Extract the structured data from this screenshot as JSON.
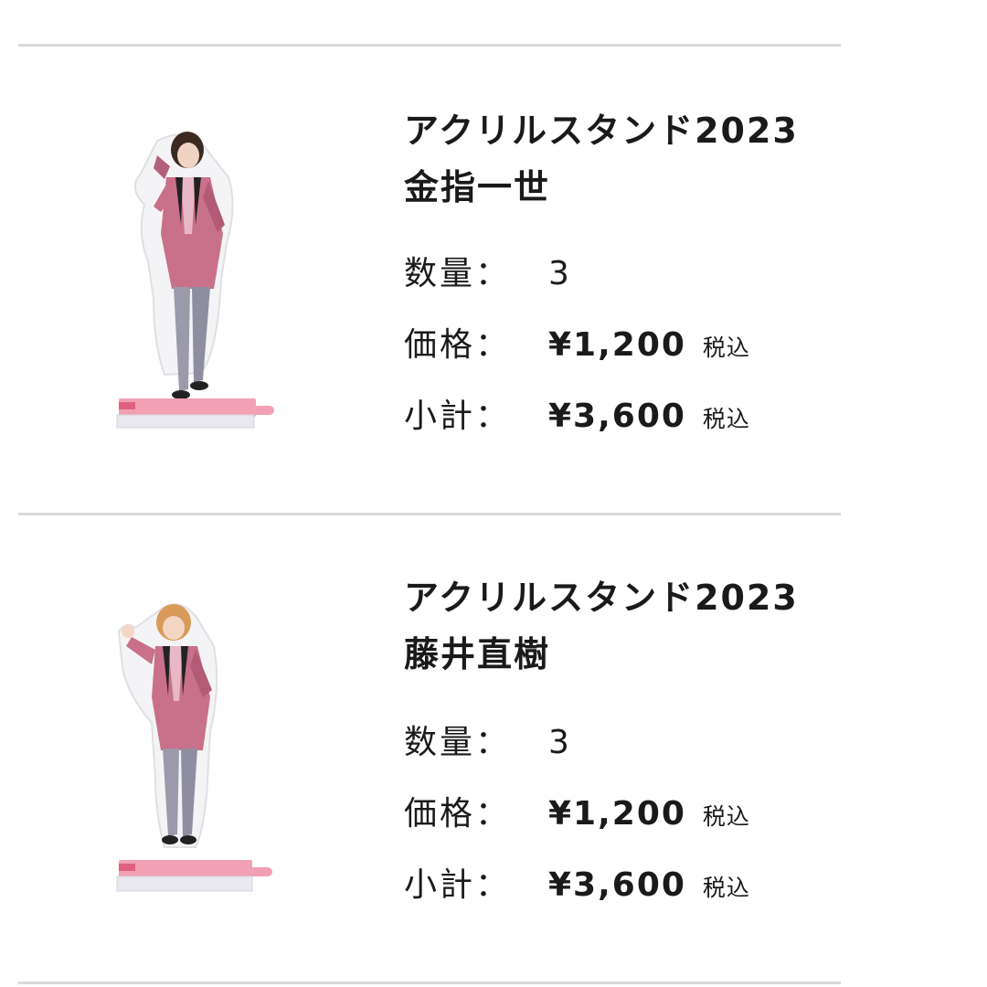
{
  "colors": {
    "divider": "#d9d9d9",
    "text": "#1a1a1a",
    "suit_pink": "#c9708a",
    "stand_base": "#f2a0b4"
  },
  "items": [
    {
      "image_icon": "acrylic-stand-figure",
      "title_line1": "アクリルスタンド2023",
      "title_line2": "金指一世",
      "quantity_label": "数量：",
      "quantity_value": "3",
      "price_label": "価格：",
      "price_value": "¥1,200",
      "price_tax": "税込",
      "subtotal_label": "小計：",
      "subtotal_value": "¥3,600",
      "subtotal_tax": "税込"
    },
    {
      "image_icon": "acrylic-stand-figure",
      "title_line1": "アクリルスタンド2023",
      "title_line2": "藤井直樹",
      "quantity_label": "数量：",
      "quantity_value": "3",
      "price_label": "価格：",
      "price_value": "¥1,200",
      "price_tax": "税込",
      "subtotal_label": "小計：",
      "subtotal_value": "¥3,600",
      "subtotal_tax": "税込"
    }
  ]
}
